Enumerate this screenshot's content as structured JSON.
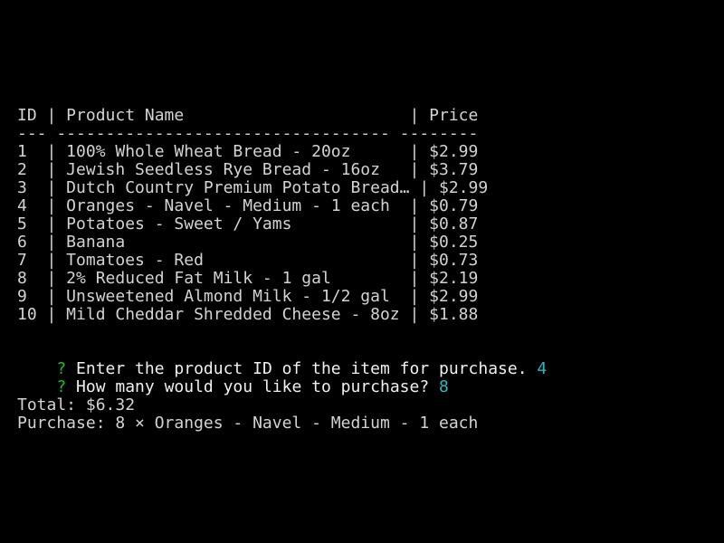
{
  "table": {
    "header_line": "ID | Product Name                       | Price",
    "separator_line": "--- ---------------------------------- --------",
    "rows": [
      "1  | 100% Whole Wheat Bread - 20oz      | $2.99",
      "2  | Jewish Seedless Rye Bread - 16oz   | $3.79",
      "3  | Dutch Country Premium Potato Bread… | $2.99",
      "4  | Oranges - Navel - Medium - 1 each  | $0.79",
      "5  | Potatoes - Sweet / Yams            | $0.87",
      "6  | Banana                             | $0.25",
      "7  | Tomatoes - Red                     | $0.73",
      "8  | 2% Reduced Fat Milk - 1 gal        | $2.19",
      "9  | Unsweetened Almond Milk - 1/2 gal  | $2.99",
      "10 | Mild Cheddar Shredded Cheese - 8oz | $1.88"
    ]
  },
  "prompts": [
    {
      "mark": "?",
      "question": " Enter the product ID of the item for purchase. ",
      "answer": "4"
    },
    {
      "mark": "?",
      "question": " How many would you like to purchase? ",
      "answer": "8"
    }
  ],
  "summary": {
    "total": "Total: $6.32",
    "purchase": "Purchase: 8 × Oranges - Navel - Medium - 1 each"
  },
  "colors": {
    "background": "#000000",
    "text": "#d3d3d3",
    "prompt_mark": "#23c023",
    "answer": "#2ab7c4"
  }
}
